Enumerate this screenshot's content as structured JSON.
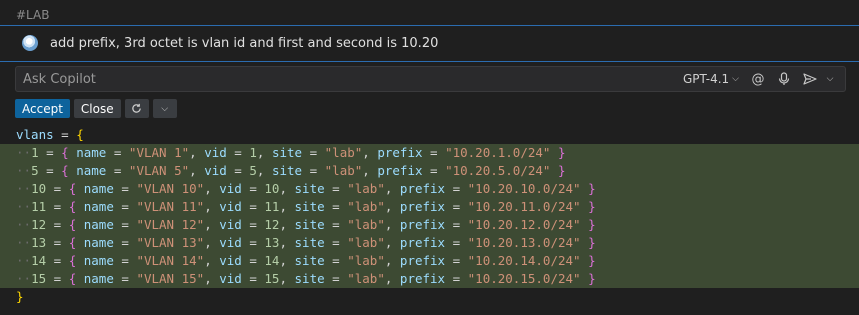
{
  "section_tag": "#LAB",
  "prompt": {
    "text": "add prefix, 3rd octet is vlan id and first and second is 10.20"
  },
  "ask_bar": {
    "placeholder": "Ask Copilot",
    "model": "GPT-4.1",
    "icons": [
      "at-icon",
      "microphone-icon",
      "send-icon",
      "chevron-down-icon"
    ]
  },
  "actions": {
    "accept_label": "Accept",
    "close_label": "Close",
    "icons": [
      "refresh-icon",
      "chevron-down-icon"
    ]
  },
  "code": {
    "var_name": "vlans",
    "entries": [
      {
        "key": "1",
        "name": "\"VLAN 1\"",
        "vid": "1",
        "site": "\"lab\"",
        "prefix": "\"10.20.1.0/24\""
      },
      {
        "key": "5",
        "name": "\"VLAN 5\"",
        "vid": "5",
        "site": "\"lab\"",
        "prefix": "\"10.20.5.0/24\""
      },
      {
        "key": "10",
        "name": "\"VLAN 10\"",
        "vid": "10",
        "site": "\"lab\"",
        "prefix": "\"10.20.10.0/24\""
      },
      {
        "key": "11",
        "name": "\"VLAN 11\"",
        "vid": "11",
        "site": "\"lab\"",
        "prefix": "\"10.20.11.0/24\""
      },
      {
        "key": "12",
        "name": "\"VLAN 12\"",
        "vid": "12",
        "site": "\"lab\"",
        "prefix": "\"10.20.12.0/24\""
      },
      {
        "key": "13",
        "name": "\"VLAN 13\"",
        "vid": "13",
        "site": "\"lab\"",
        "prefix": "\"10.20.13.0/24\""
      },
      {
        "key": "14",
        "name": "\"VLAN 14\"",
        "vid": "14",
        "site": "\"lab\"",
        "prefix": "\"10.20.14.0/24\""
      },
      {
        "key": "15",
        "name": "\"VLAN 15\"",
        "vid": "15",
        "site": "\"lab\"",
        "prefix": "\"10.20.15.0/24\""
      }
    ]
  }
}
